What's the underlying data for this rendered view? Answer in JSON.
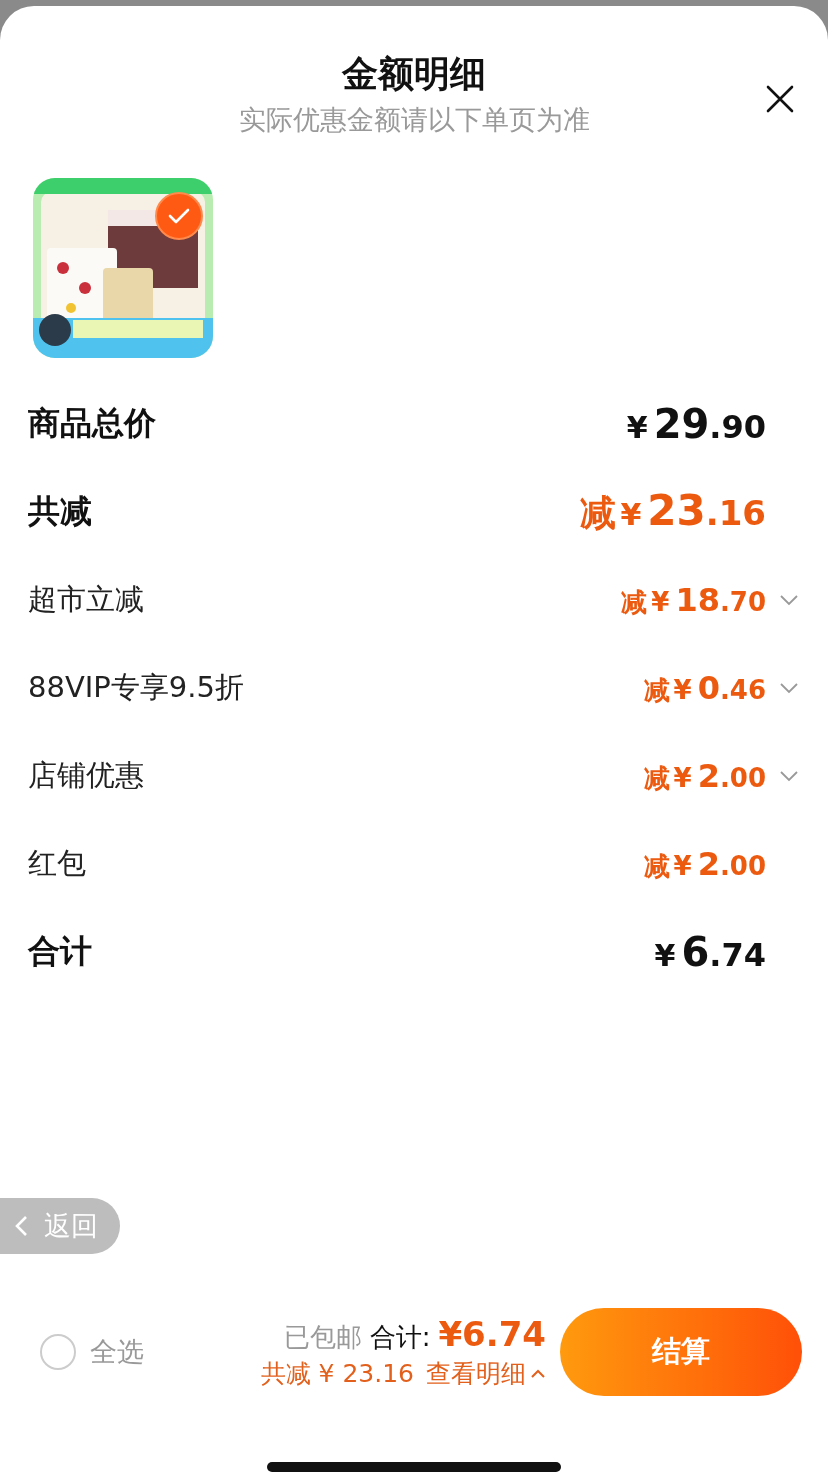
{
  "header": {
    "title": "金额明细",
    "subtitle": "实际优惠金额请以下单页为准"
  },
  "product": {
    "selected": true
  },
  "rows": [
    {
      "kind": "total",
      "label": "商品总价",
      "prefix": "",
      "currency": "¥",
      "integer": "29",
      "decimal": ".90",
      "expandable": false
    },
    {
      "kind": "discount-total",
      "label": "共减",
      "prefix": "减",
      "currency": "¥",
      "integer": "23",
      "decimal": ".16",
      "expandable": false
    },
    {
      "kind": "discount",
      "label": "超市立减",
      "prefix": "减",
      "currency": "¥",
      "integer": "18",
      "decimal": ".70",
      "expandable": true
    },
    {
      "kind": "discount",
      "label": "88VIP专享9.5折",
      "prefix": "减",
      "currency": "¥",
      "integer": "0",
      "decimal": ".46",
      "expandable": true
    },
    {
      "kind": "discount",
      "label": "店铺优惠",
      "prefix": "减",
      "currency": "¥",
      "integer": "2",
      "decimal": ".00",
      "expandable": true
    },
    {
      "kind": "discount",
      "label": "红包",
      "prefix": "减",
      "currency": "¥",
      "integer": "2",
      "decimal": ".00",
      "expandable": false
    },
    {
      "kind": "total",
      "label": "合计",
      "prefix": "",
      "currency": "¥",
      "integer": "6",
      "decimal": ".74",
      "expandable": false
    }
  ],
  "back_button": {
    "label": "返回"
  },
  "footer": {
    "select_all": {
      "label": "全选",
      "checked": false
    },
    "shipping": "已包邮",
    "total_label": "合计:",
    "total": "¥6.74",
    "saving": "共减 ¥ 23.16",
    "details_link": "查看明细",
    "checkout": "结算"
  }
}
